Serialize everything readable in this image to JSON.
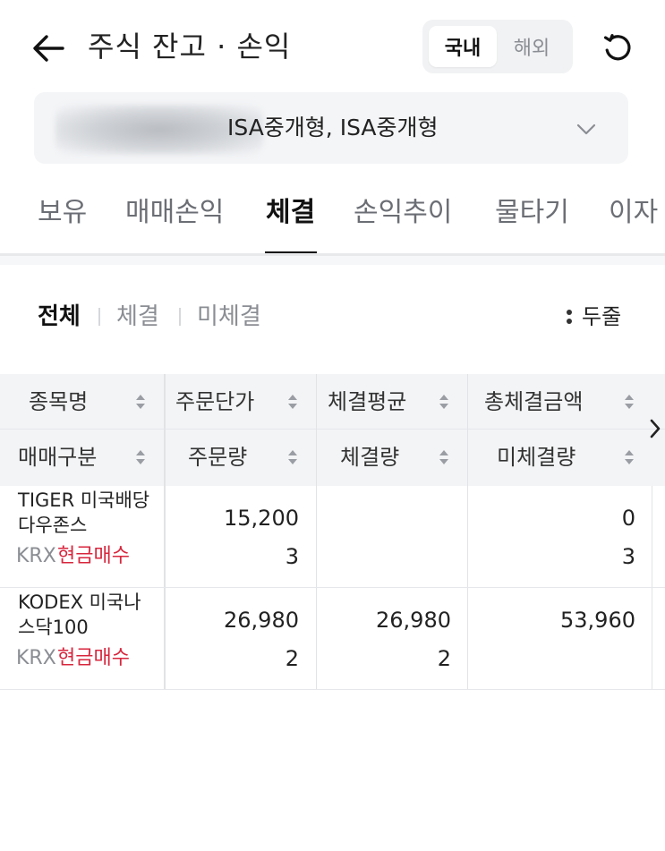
{
  "header": {
    "title": "주식 잔고 · 손익",
    "region_options": [
      "국내",
      "해외"
    ],
    "region_selected": "국내"
  },
  "account": {
    "name": "ISA중개형, ISA중개형"
  },
  "tabs": [
    {
      "label": "보유",
      "active": false
    },
    {
      "label": "매매손익",
      "active": false
    },
    {
      "label": "체결",
      "active": true
    },
    {
      "label": "손익추이",
      "active": false
    },
    {
      "label": "물타기",
      "active": false
    },
    {
      "label": "이자",
      "active": false
    }
  ],
  "filters": {
    "options": [
      "전체",
      "체결",
      "미체결"
    ],
    "selected": "전체",
    "two_line_label": "두줄"
  },
  "table": {
    "header_row1": [
      "종목명",
      "주문단가",
      "체결평균",
      "총체결금액"
    ],
    "header_row2": [
      "매매구분",
      "주문량",
      "체결량",
      "미체결량"
    ],
    "rows": [
      {
        "name": "TIGER 미국배당다우존스",
        "market": "KRX",
        "trade_type": "현금매수",
        "order_price": "15,200",
        "avg_fill_price": "",
        "total_fill_amount": "0",
        "order_qty": "3",
        "fill_qty": "",
        "unfilled_qty": "3"
      },
      {
        "name": "KODEX 미국나스닥100",
        "market": "KRX",
        "trade_type": "현금매수",
        "order_price": "26,980",
        "avg_fill_price": "26,980",
        "total_fill_amount": "53,960",
        "order_qty": "2",
        "fill_qty": "2",
        "unfilled_qty": ""
      }
    ]
  },
  "colors": {
    "trade_type_red": "#d7263d",
    "header_bg": "#f3f4f6",
    "muted_text": "#8a8d93"
  },
  "icons": [
    "back-arrow-icon",
    "refresh-icon",
    "chevron-down-icon",
    "more-options-icon",
    "sort-icon",
    "chevron-right-icon"
  ]
}
